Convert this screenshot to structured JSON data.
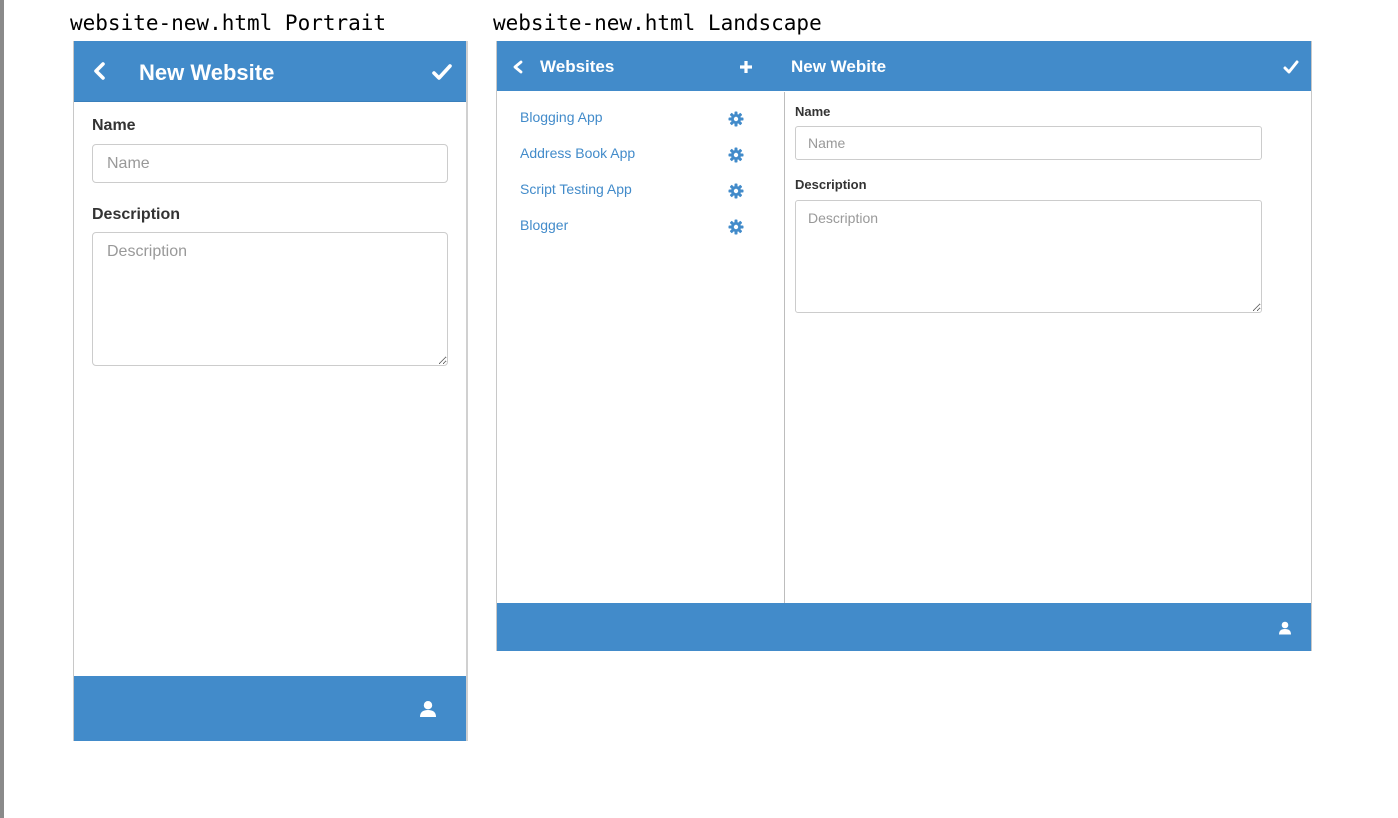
{
  "captions": {
    "portrait": "website-new.html Portrait",
    "landscape": "website-new.html Landscape"
  },
  "colors": {
    "brand": "#428bca",
    "link": "#428bca",
    "text": "#333333",
    "border": "#cccccc"
  },
  "portrait": {
    "header": {
      "back_icon": "chevron-left-icon",
      "title": "New Website",
      "confirm_icon": "checkmark-icon"
    },
    "form": {
      "name_label": "Name",
      "name_placeholder": "Name",
      "description_label": "Description",
      "description_placeholder": "Description"
    },
    "footer": {
      "user_icon": "user-icon"
    }
  },
  "landscape": {
    "header": {
      "back_icon": "chevron-left-icon",
      "list_title": "Websites",
      "add_icon": "plus-icon",
      "detail_title": "New Webite",
      "confirm_icon": "checkmark-icon"
    },
    "websites": [
      {
        "label": "Blogging App",
        "settings_icon": "gear-icon"
      },
      {
        "label": "Address Book App",
        "settings_icon": "gear-icon"
      },
      {
        "label": "Script Testing App",
        "settings_icon": "gear-icon"
      },
      {
        "label": "Blogger",
        "settings_icon": "gear-icon"
      }
    ],
    "form": {
      "name_label": "Name",
      "name_placeholder": "Name",
      "description_label": "Description",
      "description_placeholder": "Description"
    },
    "footer": {
      "user_icon": "user-icon"
    }
  }
}
